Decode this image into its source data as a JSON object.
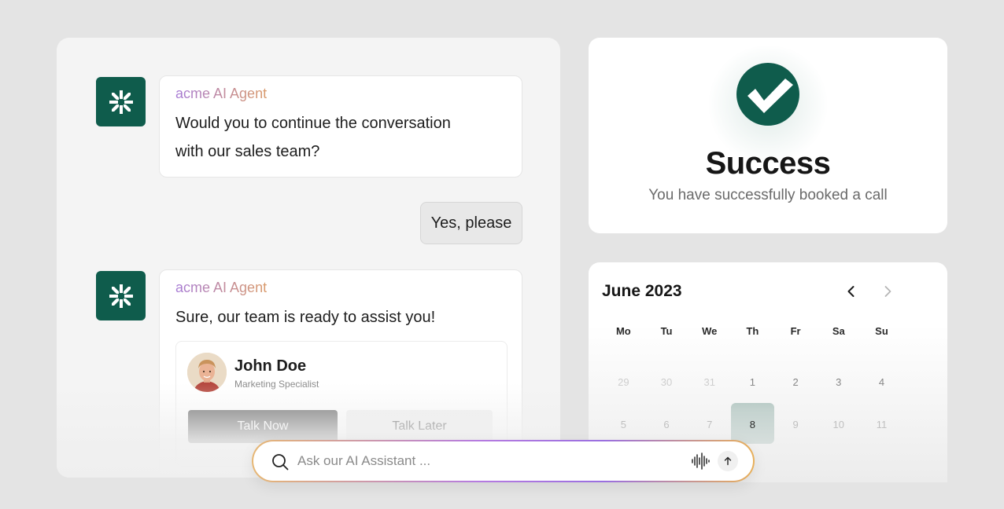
{
  "colors": {
    "brand": "#0f5c4c",
    "selected_day": "#5f8f83",
    "primary_button": "#6a6a6a"
  },
  "chat": {
    "messages": [
      {
        "sender": "acme AI Agent",
        "text_line1": "Would you to continue the conversation",
        "text_line2": "with our sales team?"
      },
      {
        "sender": "user",
        "text": "Yes, please"
      },
      {
        "sender": "acme AI Agent",
        "text": "Sure, our team is ready to assist you!"
      }
    ],
    "contact": {
      "name": "John Doe",
      "role": "Marketing Specialist",
      "primary_button": "Talk Now",
      "secondary_button": "Talk Later"
    }
  },
  "success": {
    "icon": "check-circle-icon",
    "title": "Success",
    "subtitle": "You have successfully booked a call"
  },
  "calendar": {
    "title": "June 2023",
    "weekdays": [
      "Mo",
      "Tu",
      "We",
      "Th",
      "Fr",
      "Sa",
      "Su"
    ],
    "rows": [
      [
        "29",
        "30",
        "31",
        "1",
        "2",
        "3",
        "4"
      ],
      [
        "5",
        "6",
        "7",
        "8",
        "9",
        "10",
        "11"
      ]
    ],
    "selected_day": "8"
  },
  "search": {
    "placeholder": "Ask our AI Assistant ...",
    "value": ""
  }
}
